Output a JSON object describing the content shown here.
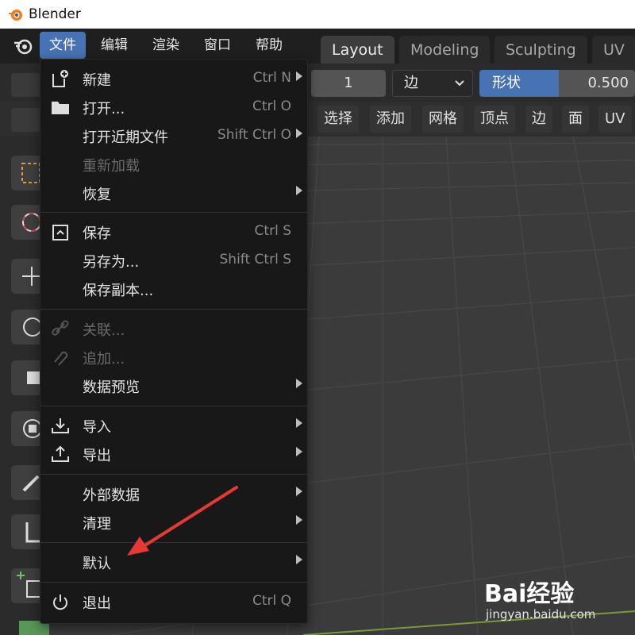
{
  "app": {
    "window_title": "Blender"
  },
  "menubar": {
    "items": [
      "文件",
      "编辑",
      "渲染",
      "窗口",
      "帮助"
    ],
    "active_index": 0
  },
  "workspaces": {
    "tabs": [
      "Layout",
      "Modeling",
      "Sculpting",
      "UV E"
    ],
    "active_index": 0
  },
  "header": {
    "number_value": "1",
    "select_value": "边",
    "shape_label": "形状",
    "shape_value": "0.500",
    "items": [
      "选择",
      "添加",
      "网格",
      "顶点",
      "边",
      "面",
      "UV"
    ]
  },
  "file_menu": {
    "items": [
      {
        "label": "新建",
        "shortcut": "Ctrl N",
        "submenu": true,
        "disabled": false,
        "icon": "new-file-icon"
      },
      {
        "label": "打开...",
        "shortcut": "Ctrl O",
        "submenu": false,
        "disabled": false,
        "icon": "folder-icon"
      },
      {
        "label": "打开近期文件",
        "shortcut": "Shift Ctrl O",
        "submenu": true,
        "disabled": false,
        "icon": ""
      },
      {
        "label": "重新加载",
        "shortcut": "",
        "submenu": false,
        "disabled": true,
        "icon": ""
      },
      {
        "label": "恢复",
        "shortcut": "",
        "submenu": true,
        "disabled": false,
        "icon": ""
      },
      {
        "label": "保存",
        "shortcut": "Ctrl S",
        "submenu": false,
        "disabled": false,
        "icon": "save-icon"
      },
      {
        "label": "另存为...",
        "shortcut": "Shift Ctrl S",
        "submenu": false,
        "disabled": false,
        "icon": ""
      },
      {
        "label": "保存副本...",
        "shortcut": "",
        "submenu": false,
        "disabled": false,
        "icon": ""
      },
      {
        "label": "关联...",
        "shortcut": "",
        "submenu": false,
        "disabled": true,
        "icon": "link-icon"
      },
      {
        "label": "追加...",
        "shortcut": "",
        "submenu": false,
        "disabled": true,
        "icon": "append-icon"
      },
      {
        "label": "数据预览",
        "shortcut": "",
        "submenu": true,
        "disabled": false,
        "icon": ""
      },
      {
        "label": "导入",
        "shortcut": "",
        "submenu": true,
        "disabled": false,
        "icon": "import-icon"
      },
      {
        "label": "导出",
        "shortcut": "",
        "submenu": true,
        "disabled": false,
        "icon": "export-icon"
      },
      {
        "label": "外部数据",
        "shortcut": "",
        "submenu": true,
        "disabled": false,
        "icon": ""
      },
      {
        "label": "清理",
        "shortcut": "",
        "submenu": true,
        "disabled": false,
        "icon": ""
      },
      {
        "label": "默认",
        "shortcut": "",
        "submenu": true,
        "disabled": false,
        "icon": ""
      },
      {
        "label": "退出",
        "shortcut": "Ctrl Q",
        "submenu": false,
        "disabled": false,
        "icon": "power-icon"
      }
    ]
  },
  "annotation": {
    "arrow_color": "#e53935"
  },
  "colors": {
    "accent": "#4772b3",
    "menu_bg": "#181818"
  },
  "watermark": {
    "brand": "Bai经验",
    "url": "jingyan.baidu.com"
  }
}
